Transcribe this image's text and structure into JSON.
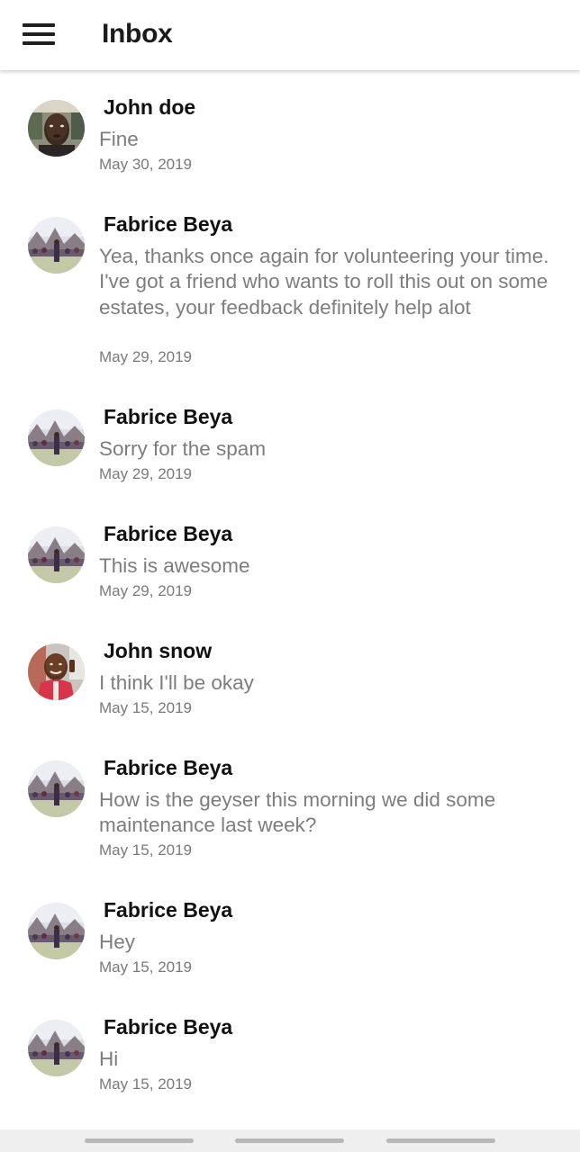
{
  "app_bar": {
    "title": "Inbox",
    "menu_icon": "hamburger-menu-icon"
  },
  "messages": [
    {
      "sender": "John doe",
      "text": "Fine",
      "date": "May 30, 2019",
      "avatar": "photo-dark-portrait"
    },
    {
      "sender": "Fabrice Beya",
      "text": "Yea, thanks once again for volunteering your time. I've got a friend who wants to roll this out on some estates, your feedback definitely help alot",
      "date": "May 29, 2019",
      "avatar": "photo-landmark-crowd"
    },
    {
      "sender": "Fabrice Beya",
      "text": "Sorry for the spam",
      "date": "May 29, 2019",
      "avatar": "photo-landmark-crowd"
    },
    {
      "sender": "Fabrice Beya",
      "text": "This is awesome",
      "date": "May 29, 2019",
      "avatar": "photo-landmark-crowd"
    },
    {
      "sender": "John snow",
      "text": "I think I'll be okay",
      "date": "May 15, 2019",
      "avatar": "photo-red-shirt-portrait"
    },
    {
      "sender": "Fabrice Beya",
      "text": "How is the geyser this morning we did some maintenance last week?",
      "date": "May 15, 2019",
      "avatar": "photo-landmark-crowd"
    },
    {
      "sender": "Fabrice Beya",
      "text": "Hey",
      "date": "May 15, 2019",
      "avatar": "photo-landmark-crowd"
    },
    {
      "sender": "Fabrice Beya",
      "text": "Hi",
      "date": "May 15, 2019",
      "avatar": "photo-landmark-crowd"
    }
  ],
  "colors": {
    "sender_text": "#111111",
    "message_text": "#7d7d7d",
    "date_text": "#7a7a7a",
    "app_bar_bg": "#ffffff"
  }
}
